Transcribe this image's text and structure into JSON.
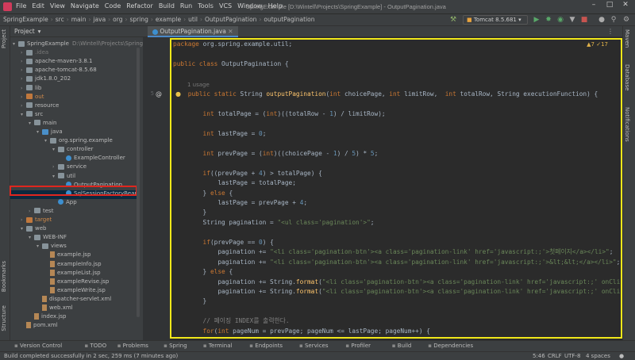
{
  "window": {
    "title": "SpringExample [D:\\Wintell\\Projects\\SpringExample] - OutputPagination.java",
    "menu": [
      "File",
      "Edit",
      "View",
      "Navigate",
      "Code",
      "Refactor",
      "Build",
      "Run",
      "Tools",
      "VCS",
      "Window",
      "Help"
    ]
  },
  "breadcrumbs": [
    "SpringExample",
    "src",
    "main",
    "java",
    "org",
    "spring",
    "example",
    "util",
    "OutputPagination",
    "outputPagination"
  ],
  "run_config": "Tomcat 8.5.681",
  "left_tabs": {
    "project": "Project",
    "bookmarks": "Bookmarks",
    "structure": "Structure"
  },
  "right_tabs": {
    "maven": "Maven",
    "database": "Database",
    "notifications": "Notifications"
  },
  "project_panel": {
    "header": "Project",
    "tree": [
      {
        "label": "SpringExample",
        "extra": "D:\\Wintell\\Projects\\SpringExample",
        "depth": 0,
        "icon": "folder-icon"
      },
      {
        "label": ".idea",
        "depth": 1,
        "icon": "folder-icon"
      },
      {
        "label": "apache-maven-3.8.1",
        "depth": 1,
        "icon": "folder-icon"
      },
      {
        "label": "apache-tomcat-8.5.68",
        "depth": 1,
        "icon": "folder-icon"
      },
      {
        "label": "jdk1.8.0_202",
        "depth": 1,
        "icon": "folder-icon"
      },
      {
        "label": "lib",
        "depth": 1,
        "icon": "folder-icon"
      },
      {
        "label": "out",
        "depth": 1,
        "icon": "folder-orange-icon"
      },
      {
        "label": "resource",
        "depth": 1,
        "icon": "folder-icon"
      },
      {
        "label": "src",
        "depth": 1,
        "icon": "folder-icon"
      },
      {
        "label": "main",
        "depth": 2,
        "icon": "folder-icon"
      },
      {
        "label": "java",
        "depth": 3,
        "icon": "folder-blue-icon"
      },
      {
        "label": "org.spring.example",
        "depth": 4,
        "icon": "package-icon"
      },
      {
        "label": "controller",
        "depth": 5,
        "icon": "package-icon"
      },
      {
        "label": "ExampleController",
        "depth": 6,
        "icon": "class-icon"
      },
      {
        "label": "service",
        "depth": 5,
        "icon": "package-icon"
      },
      {
        "label": "util",
        "depth": 5,
        "icon": "package-icon"
      },
      {
        "label": "OutputPagination",
        "depth": 6,
        "icon": "class-icon"
      },
      {
        "label": "SqlSessionFactoryBean",
        "depth": 6,
        "icon": "class-icon"
      },
      {
        "label": "App",
        "depth": 5,
        "icon": "class-icon"
      },
      {
        "label": "test",
        "depth": 2,
        "icon": "folder-icon"
      },
      {
        "label": "target",
        "depth": 1,
        "icon": "folder-orange-icon"
      },
      {
        "label": "web",
        "depth": 1,
        "icon": "folder-icon"
      },
      {
        "label": "WEB-INF",
        "depth": 2,
        "icon": "folder-icon"
      },
      {
        "label": "views",
        "depth": 3,
        "icon": "folder-icon"
      },
      {
        "label": "example.jsp",
        "depth": 4,
        "icon": "file-icon"
      },
      {
        "label": "exampleInfo.jsp",
        "depth": 4,
        "icon": "file-icon"
      },
      {
        "label": "exampleList.jsp",
        "depth": 4,
        "icon": "file-icon"
      },
      {
        "label": "exampleRevise.jsp",
        "depth": 4,
        "icon": "file-icon"
      },
      {
        "label": "exampleWrite.jsp",
        "depth": 4,
        "icon": "file-icon"
      },
      {
        "label": "dispatcher-servlet.xml",
        "depth": 3,
        "icon": "file-icon"
      },
      {
        "label": "web.xml",
        "depth": 3,
        "icon": "file-icon"
      },
      {
        "label": "index.jsp",
        "depth": 2,
        "icon": "file-icon"
      },
      {
        "label": "pom.xml",
        "depth": 1,
        "icon": "file-icon"
      }
    ]
  },
  "editor": {
    "tab": "OutputPagination.java",
    "inspection": "▲7 ✓17",
    "usage_hint": "1 usage",
    "lines": [
      {
        "n": "",
        "tokens": [
          [
            "kw",
            "package "
          ],
          [
            "plain",
            "org.spring.example.util;"
          ]
        ]
      },
      {
        "n": "",
        "tokens": []
      },
      {
        "n": "",
        "tokens": [
          [
            "kw",
            "public class "
          ],
          [
            "plain",
            "OutputPagination {"
          ]
        ]
      },
      {
        "n": "",
        "tokens": []
      },
      {
        "n": "5",
        "tokens": [
          [
            "kw",
            "    public static "
          ],
          [
            "plain",
            "String "
          ],
          [
            "fn",
            "outputPagination"
          ],
          [
            "plain",
            "("
          ],
          [
            "kw",
            "int "
          ],
          [
            "plain",
            "choicePage, "
          ],
          [
            "kw",
            "int "
          ],
          [
            "plain",
            "limitRow,  "
          ],
          [
            "kw",
            "int "
          ],
          [
            "plain",
            "totalRow, String executionFunction) {"
          ]
        ]
      },
      {
        "n": "",
        "tokens": []
      },
      {
        "n": "",
        "tokens": [
          [
            "kw",
            "        int "
          ],
          [
            "plain",
            "totalPage = ("
          ],
          [
            "kw",
            "int"
          ],
          [
            "plain",
            ")((totalRow - "
          ],
          [
            "num",
            "1"
          ],
          [
            "plain",
            ") / limitRow);"
          ]
        ]
      },
      {
        "n": "",
        "tokens": []
      },
      {
        "n": "",
        "tokens": [
          [
            "kw",
            "        int "
          ],
          [
            "plain",
            "lastPage = "
          ],
          [
            "num",
            "0"
          ],
          [
            "plain",
            ";"
          ]
        ]
      },
      {
        "n": "",
        "tokens": []
      },
      {
        "n": "",
        "tokens": [
          [
            "kw",
            "        int "
          ],
          [
            "plain",
            "prevPage = ("
          ],
          [
            "kw",
            "int"
          ],
          [
            "plain",
            ")((choicePage - "
          ],
          [
            "num",
            "1"
          ],
          [
            "plain",
            ") / "
          ],
          [
            "num",
            "5"
          ],
          [
            "plain",
            ") * "
          ],
          [
            "num",
            "5"
          ],
          [
            "plain",
            ";"
          ]
        ]
      },
      {
        "n": "",
        "tokens": []
      },
      {
        "n": "",
        "tokens": [
          [
            "kw",
            "        if"
          ],
          [
            "plain",
            "((prevPage + "
          ],
          [
            "num",
            "4"
          ],
          [
            "plain",
            ") > totalPage) {"
          ]
        ]
      },
      {
        "n": "",
        "tokens": [
          [
            "plain",
            "            lastPage = totalPage;"
          ]
        ]
      },
      {
        "n": "",
        "tokens": [
          [
            "plain",
            "        } "
          ],
          [
            "kw",
            "else "
          ],
          [
            "plain",
            "{"
          ]
        ]
      },
      {
        "n": "",
        "tokens": [
          [
            "plain",
            "            lastPage = prevPage + "
          ],
          [
            "num",
            "4"
          ],
          [
            "plain",
            ";"
          ]
        ]
      },
      {
        "n": "",
        "tokens": [
          [
            "plain",
            "        }"
          ]
        ]
      },
      {
        "n": "",
        "tokens": [
          [
            "plain",
            "        String pagination = "
          ],
          [
            "str",
            "\"<ul class='pagination'>\""
          ],
          [
            "plain",
            ";"
          ]
        ]
      },
      {
        "n": "",
        "tokens": []
      },
      {
        "n": "",
        "tokens": [
          [
            "kw",
            "        if"
          ],
          [
            "plain",
            "(prevPage == "
          ],
          [
            "num",
            "0"
          ],
          [
            "plain",
            ") {"
          ]
        ]
      },
      {
        "n": "",
        "tokens": [
          [
            "plain",
            "            pagination += "
          ],
          [
            "str",
            "\"<li class='pagination-btn'><a class='pagination-link' href='javascript:;'>첫페이지</a></li>\""
          ],
          [
            "plain",
            ";"
          ]
        ]
      },
      {
        "n": "",
        "tokens": [
          [
            "plain",
            "            pagination += "
          ],
          [
            "str",
            "\"<li class='pagination-btn'><a class='pagination-link' href='javascript:;'>&lt;&lt;</a></li>\""
          ],
          [
            "plain",
            ";"
          ]
        ]
      },
      {
        "n": "",
        "tokens": [
          [
            "plain",
            "        } "
          ],
          [
            "kw",
            "else "
          ],
          [
            "plain",
            "{"
          ]
        ]
      },
      {
        "n": "",
        "tokens": [
          [
            "plain",
            "            pagination += String."
          ],
          [
            "fn",
            "format"
          ],
          [
            "plain",
            "("
          ],
          [
            "str",
            "\"<li class='pagination-btn'><a class='pagination-link' href='javascript:;' onClick="
          ]
        ]
      },
      {
        "n": "",
        "tokens": [
          [
            "plain",
            "            pagination += String."
          ],
          [
            "fn",
            "format"
          ],
          [
            "plain",
            "("
          ],
          [
            "str",
            "\"<li class='pagination-btn'><a class='pagination-link' href='javascript:;' onClick="
          ]
        ]
      },
      {
        "n": "",
        "tokens": [
          [
            "plain",
            "        }"
          ]
        ]
      },
      {
        "n": "",
        "tokens": []
      },
      {
        "n": "",
        "tokens": [
          [
            "cm",
            "        // 페이징 INDEX를 출력한다."
          ]
        ]
      },
      {
        "n": "",
        "tokens": [
          [
            "kw",
            "        for"
          ],
          [
            "plain",
            "("
          ],
          [
            "kw",
            "int "
          ],
          [
            "plain",
            "pageNum = prevPage; pageNum <= lastPage; pageNum++) {"
          ]
        ]
      }
    ]
  },
  "bottom_tools": [
    "Version Control",
    "TODO",
    "Problems",
    "Spring",
    "Terminal",
    "Endpoints",
    "Services",
    "Profiler",
    "Build",
    "Dependencies"
  ],
  "status": {
    "message": "Build completed successfully in 2 sec, 259 ms (7 minutes ago)",
    "position": "5:46",
    "line_sep": "CRLF",
    "encoding": "UTF-8",
    "indent": "4 spaces"
  }
}
